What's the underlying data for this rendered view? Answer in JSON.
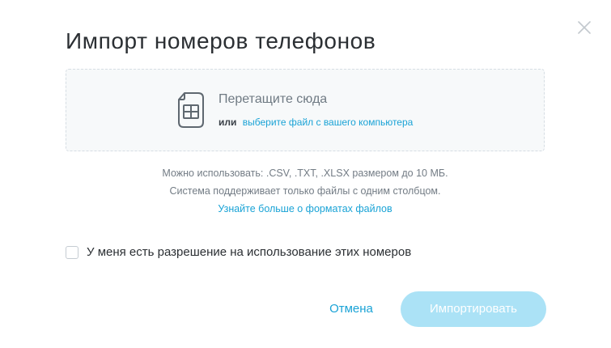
{
  "dialog": {
    "title": "Импорт номеров телефонов",
    "close_icon": "close-icon"
  },
  "dropzone": {
    "icon": "spreadsheet-file-icon",
    "title": "Перетащите сюда",
    "or_text": "или",
    "browse_link": "выберите файл с вашего компьютера"
  },
  "info": {
    "line1": "Можно использовать: .CSV, .TXT, .XLSX размером до 10 МБ.",
    "line2": "Система поддерживает только файлы с одним столбцом.",
    "link": "Узнайте больше о форматах файлов"
  },
  "permission": {
    "label": "У меня есть разрешение на использование этих номеров",
    "checked": false
  },
  "buttons": {
    "cancel": "Отмена",
    "import": "Импортировать",
    "import_enabled": false
  },
  "colors": {
    "accent": "#1aa3d6",
    "import_disabled_bg": "#abe2f6",
    "dropzone_bg": "#f7f9fa",
    "dropzone_border": "#d6dde3"
  }
}
